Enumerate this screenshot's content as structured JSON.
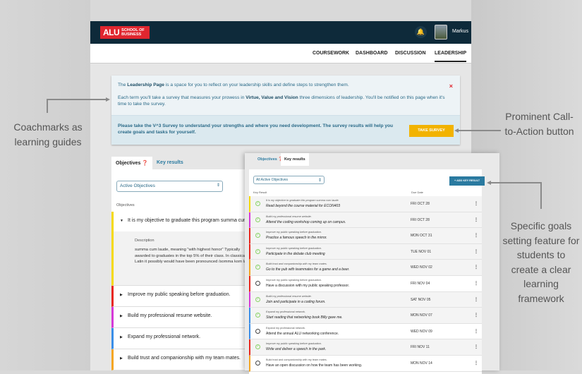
{
  "header": {
    "logo_main": "ALU",
    "logo_sub1": "SCHOOL OF",
    "logo_sub2": "BUSINESS",
    "user": "Markus",
    "bell_icon": "bell-icon"
  },
  "nav": [
    "COURSEWORK",
    "DASHBOARD",
    "DISCUSSION",
    "LEADERSHIP"
  ],
  "coachmark": {
    "p1_a": "The ",
    "p1_b": "Leadership Page",
    "p1_c": " is a space for you to reflect on your leadership skills and define steps to strengthen them.",
    "p2_a": "Each term you'll take a survey that measures your prowess in ",
    "p2_b": "Virtue, Value and Vision",
    "p2_c": " three dimensions of leadership. You'll be notified on this page when it's time to take the survey.",
    "cta_text": "Please take the V^3 Survey to understand your strengths and where you need development. The survey results will help you create goals and tasks for yourself.",
    "cta_button": "TAKE SURVEY",
    "close": "×"
  },
  "objectives_panel": {
    "tab_objectives": "Objectives ❓",
    "tab_key_results": "Key results",
    "select": "Active Objectives",
    "col": "Objectives",
    "expanded": {
      "title": "It is my objective to graduate this program summa cum laude.",
      "desc_label": "Description",
      "desc": "summa cum laude, meaning \"with highest honor\" Typically awarded to graduates in the top 5% of their class. In classical Latin it possibly would have been pronounced /somma kom laudo/"
    },
    "items": [
      {
        "title": "Improve my public speaking before graduation.",
        "color": "#e8271e"
      },
      {
        "title": "Build my professional resume website.",
        "color": "#d63ad8"
      },
      {
        "title": "Expand my professional network.",
        "color": "#3a8ee8"
      },
      {
        "title": "Build trust and companionship with my team mates.",
        "color": "#f5a623"
      }
    ]
  },
  "key_results_panel": {
    "tab_objectives": "Objectives ❓",
    "tab_key_results": "Key results",
    "select": "All Active Objectives",
    "add_button": "+ ADD KEY RESULT",
    "col_result": "Key Result",
    "col_due": "Due Date",
    "rows": [
      {
        "objective": "It is my objective to graduate this program summa cum laude.",
        "result": "Read beyond the course material for ECON403",
        "due": "FRI OCT 28",
        "done": true,
        "color": "#f5d90a"
      },
      {
        "objective": "Build my professional resume website.",
        "result": "Attend the coding workshop coming up on campus.",
        "due": "FRI OCT 28",
        "done": true,
        "color": "#d63ad8"
      },
      {
        "objective": "Improve my public speaking before graduation.",
        "result": "Practice a famous speech in the mirror.",
        "due": "MON OCT 31",
        "done": true,
        "color": "#e8271e"
      },
      {
        "objective": "Improve my public speaking before graduation.",
        "result": "Participate in the debate club meeting",
        "due": "TUE NOV 01",
        "done": true,
        "color": "#e8271e"
      },
      {
        "objective": "Build trust and companionship with my team mates.",
        "result": "Go to the pub with teammates for a game and a beer.",
        "due": "WED NOV 02",
        "done": true,
        "color": "#f5a623"
      },
      {
        "objective": "Improve my public speaking before graduation.",
        "result": "Have a discussion with my public speaking professor.",
        "due": "FRI NOV 04",
        "done": false,
        "color": "#e8271e"
      },
      {
        "objective": "Build my professional resume website.",
        "result": "Join and participate in a coding forum.",
        "due": "SAT NOV 05",
        "done": true,
        "color": "#d63ad8"
      },
      {
        "objective": "Expand my professional network.",
        "result": "Start reading that networking book Billy gave me.",
        "due": "MON NOV 07",
        "done": true,
        "color": "#3a8ee8"
      },
      {
        "objective": "Expand my professional network.",
        "result": "Attend the annual ALU networking conference.",
        "due": "WED NOV 09",
        "done": false,
        "color": "#3a8ee8"
      },
      {
        "objective": "Improve my public speaking before graduation.",
        "result": "Write and deliver a speech in the park.",
        "due": "FRI NOV 11",
        "done": true,
        "color": "#e8271e"
      },
      {
        "objective": "Build trust and companionship with my team mates.",
        "result": "Have an open discussion on how the team has been working.",
        "due": "MON NOV 14",
        "done": false,
        "color": "#f5a623"
      }
    ]
  },
  "annotations": {
    "coachmarks": "Coachmarks as learning guides",
    "cta": "Prominent Call-to-Action button",
    "goals": "Specific goals setting feature for students to create a clear learning framework"
  }
}
